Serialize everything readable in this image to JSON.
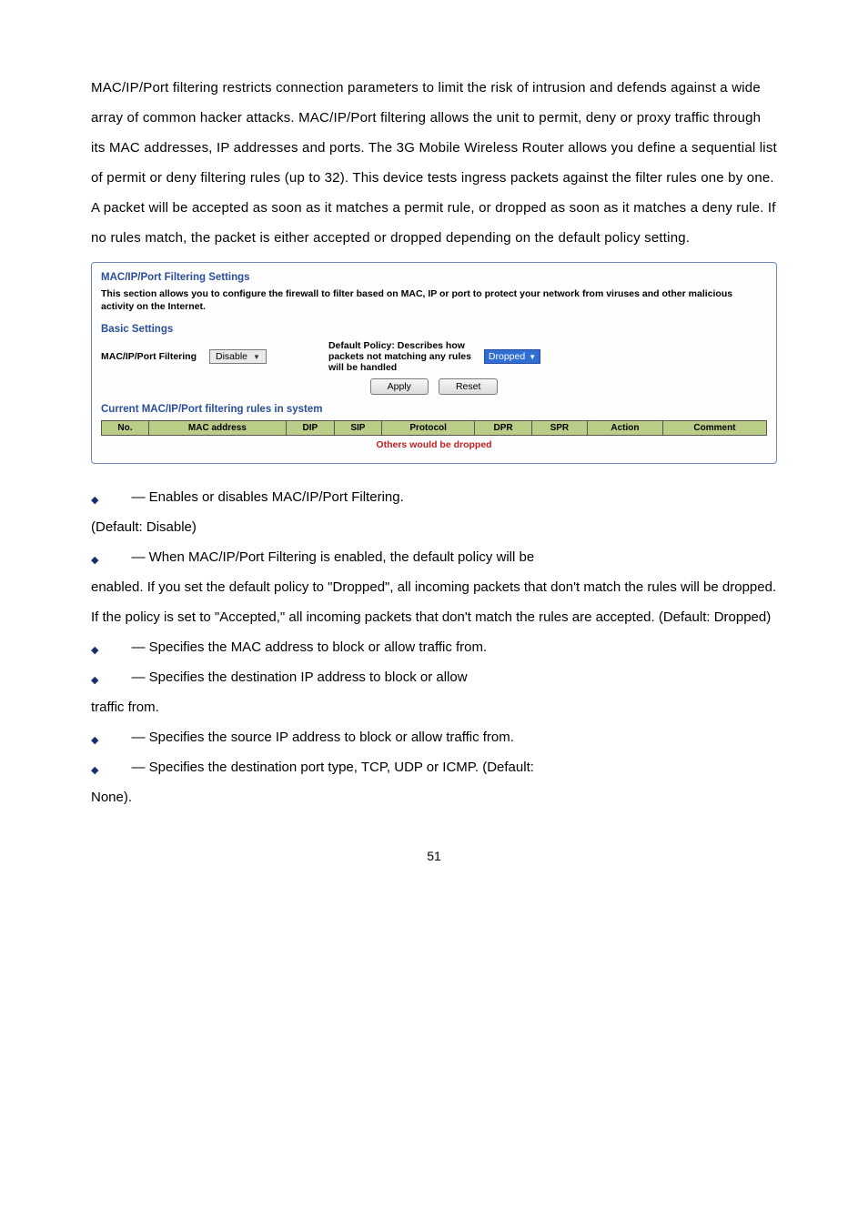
{
  "intro": "MAC/IP/Port filtering restricts connection parameters to limit the risk of intrusion and defends against a wide array of common hacker attacks. MAC/IP/Port filtering allows the unit to permit, deny or proxy traffic through its MAC addresses, IP addresses and ports. The 3G Mobile Wireless Router allows you define a sequential list of permit or deny filtering rules (up to 32). This device tests ingress packets against the filter rules one by one. A packet will be accepted as soon as it matches a permit rule, or dropped as soon as it matches a deny rule. If no rules match, the packet is either accepted or dropped depending on the default policy setting.",
  "box": {
    "title": "MAC/IP/Port Filtering Settings",
    "desc": "This section allows you to configure the firewall to filter based on MAC, IP or port to protect your network from viruses and other malicious activity on the Internet.",
    "basic": "Basic Settings",
    "filter_label": "MAC/IP/Port Filtering",
    "filter_value": "Disable",
    "policy_l1": "Default Policy: Describes how",
    "policy_l2": "packets not matching any rules",
    "policy_l3": "will be handled",
    "dropped": "Dropped",
    "apply": "Apply",
    "reset": "Reset",
    "current": "Current MAC/IP/Port filtering rules in system",
    "headers": {
      "no": "No.",
      "mac": "MAC address",
      "dip": "DIP",
      "sip": "SIP",
      "protocol": "Protocol",
      "dpr": "DPR",
      "spr": "SPR",
      "action": "Action",
      "comment": "Comment"
    },
    "others": "Others would be dropped"
  },
  "bullets": {
    "b1": " — Enables or disables MAC/IP/Port Filtering.",
    "b1_after": "(Default: Disable)",
    "b2": " — When MAC/IP/Port Filtering is enabled, the default policy will be",
    "b2_cont": "enabled. If you set the default policy to \"Dropped\", all incoming packets that don't match the rules will be dropped. If the policy is set to \"Accepted,\" all incoming packets that don't match the rules are accepted. (Default: Dropped)",
    "b3": " — Specifies the MAC address to block or allow traffic from.",
    "b4": " — Specifies the destination IP address to block or allow",
    "b4_after": "traffic from.",
    "b5": " — Specifies the source IP address to block or allow traffic from.",
    "b6": " — Specifies the destination port type, TCP, UDP or ICMP. (Default:",
    "b6_after": "None)."
  },
  "page_num": "51"
}
